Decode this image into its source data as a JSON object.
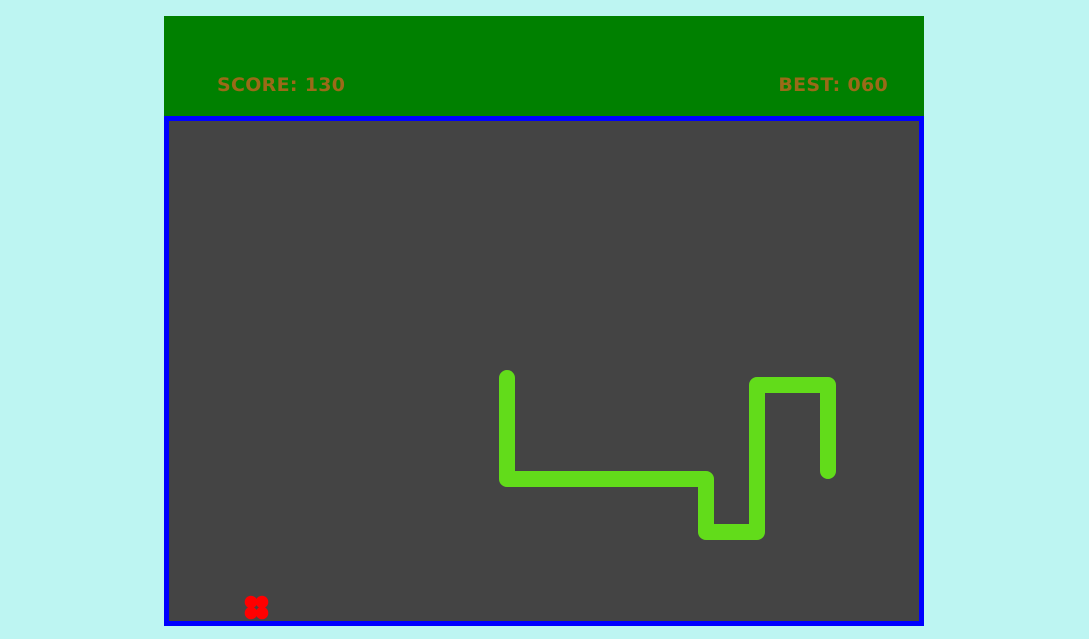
{
  "scoreboard": {
    "score_label": "SCORE:",
    "score_value": "130",
    "best_label": "BEST:",
    "best_value": "060"
  },
  "colors": {
    "background": "#bdf5f2",
    "header": "#008000",
    "score_text": "#9a6a18",
    "board": "#444444",
    "board_border": "#0000ff",
    "snake": "#62dc1a",
    "food": "#ff0000"
  },
  "icons": {
    "snake": "snake-icon",
    "food": "food-icon"
  }
}
